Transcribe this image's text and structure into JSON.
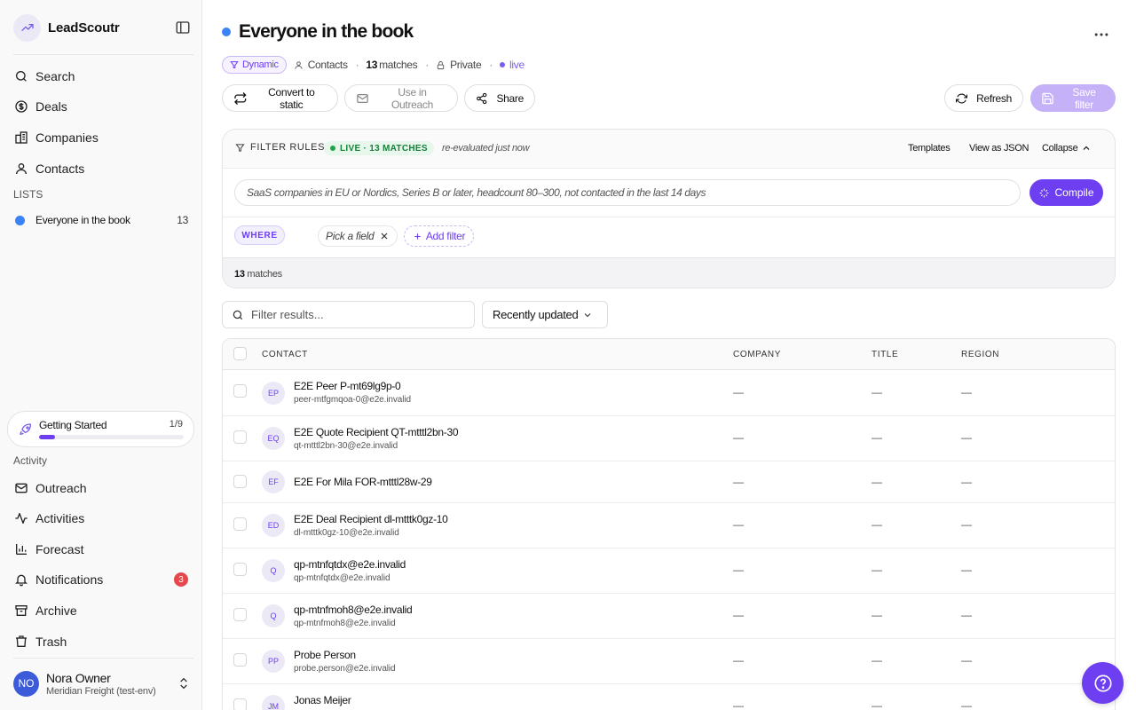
{
  "app": {
    "name": "LeadScoutr"
  },
  "sidebar": {
    "nav": [
      {
        "label": "Search",
        "icon": "search-icon"
      },
      {
        "label": "Deals",
        "icon": "dollar-icon"
      },
      {
        "label": "Companies",
        "icon": "building-icon"
      },
      {
        "label": "Contacts",
        "icon": "user-icon"
      }
    ],
    "lists_label": "LISTS",
    "lists": [
      {
        "label": "Everyone in the book",
        "count": "13",
        "color": "#3b82f6"
      }
    ],
    "getting_started": {
      "label": "Getting Started",
      "count": "1/9",
      "progress": 0.11
    },
    "activity_label": "Activity",
    "activity": [
      {
        "label": "Outreach",
        "icon": "mail-icon"
      },
      {
        "label": "Activities",
        "icon": "activity-icon"
      },
      {
        "label": "Forecast",
        "icon": "bar-chart-icon"
      },
      {
        "label": "Notifications",
        "icon": "bell-icon",
        "badge": "3"
      },
      {
        "label": "Archive",
        "icon": "archive-icon"
      },
      {
        "label": "Trash",
        "icon": "trash-icon"
      }
    ],
    "user": {
      "initials": "NO",
      "name": "Nora Owner",
      "org": "Meridian Freight (test-env)"
    }
  },
  "header": {
    "title": "Everyone in the book",
    "dynamic_label": "Dynamic",
    "entity_label": "Contacts",
    "match_count": "13",
    "matches_word": "matches",
    "visibility": "Private",
    "status": "live"
  },
  "actions": {
    "convert": "Convert to static",
    "outreach": "Use in Outreach",
    "share": "Share",
    "refresh": "Refresh",
    "save_filter": "Save filter"
  },
  "filter_panel": {
    "title": "FILTER RULES",
    "live_badge": "LIVE · 13 MATCHES",
    "reevaluated": "re-evaluated just now",
    "templates": "Templates",
    "view_json": "View as JSON",
    "collapse": "Collapse",
    "nl_placeholder": "SaaS companies in EU or Nordics, Series B or later, headcount 80–300, not contacted in the last 14 days",
    "compile": "Compile",
    "where": "WHERE",
    "pick_field": "Pick a field",
    "add_filter": "Add filter",
    "footer_count": "13",
    "footer_word": "matches"
  },
  "results": {
    "search_placeholder": "Filter results...",
    "sort": "Recently updated"
  },
  "table": {
    "columns": [
      "CONTACT",
      "COMPANY",
      "TITLE",
      "REGION"
    ],
    "rows": [
      {
        "initials": "EP",
        "name": "E2E Peer P-mt69lg9p-0",
        "email": "peer-mtfgmqoa-0@e2e.invalid",
        "company": "—",
        "title": "—",
        "region": "—"
      },
      {
        "initials": "EQ",
        "name": "E2E Quote Recipient QT-mtttl2bn-30",
        "email": "qt-mtttl2bn-30@e2e.invalid",
        "company": "—",
        "title": "—",
        "region": "—"
      },
      {
        "initials": "EF",
        "name": "E2E For Mila FOR-mtttl28w-29",
        "email": "",
        "company": "—",
        "title": "—",
        "region": "—"
      },
      {
        "initials": "ED",
        "name": "E2E Deal Recipient dl-mtttk0gz-10",
        "email": "dl-mtttk0gz-10@e2e.invalid",
        "company": "—",
        "title": "—",
        "region": "—"
      },
      {
        "initials": "Q",
        "name": "qp-mtnfqtdx@e2e.invalid",
        "email": "qp-mtnfqtdx@e2e.invalid",
        "company": "—",
        "title": "—",
        "region": "—"
      },
      {
        "initials": "Q",
        "name": "qp-mtnfmoh8@e2e.invalid",
        "email": "qp-mtnfmoh8@e2e.invalid",
        "company": "—",
        "title": "—",
        "region": "—"
      },
      {
        "initials": "PP",
        "name": "Probe Person",
        "email": "probe.person@e2e.invalid",
        "company": "—",
        "title": "—",
        "region": "—"
      },
      {
        "initials": "JM",
        "name": "Jonas Meijer",
        "email": "",
        "company": "—",
        "title": "—",
        "region": "—"
      }
    ]
  },
  "colors": {
    "accent": "#6d3ff0",
    "list_dot": "#3b82f6",
    "live_green": "#22a34a",
    "badge_red": "#e5484d"
  }
}
